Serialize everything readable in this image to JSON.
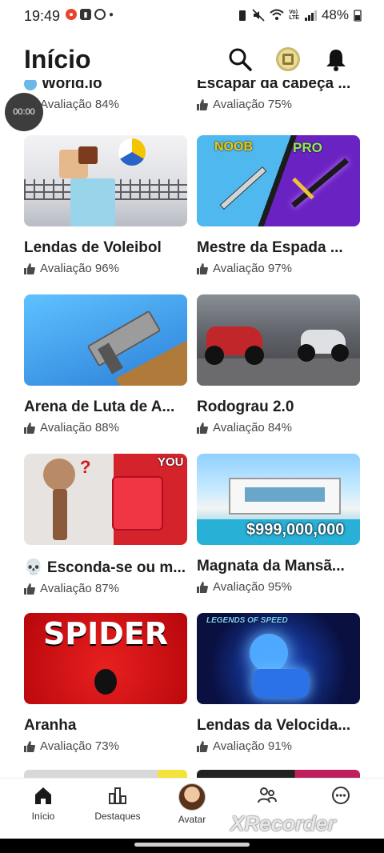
{
  "status": {
    "time": "19:49",
    "battery": "48%"
  },
  "header": {
    "title": "Início"
  },
  "partial": [
    {
      "title": "World.io",
      "rating": "Avaliação 84%"
    },
    {
      "title": "Escapar da cabeça ...",
      "rating": "Avaliação 75%"
    }
  ],
  "games": [
    {
      "title": "Lendas de Voleibol",
      "rating": "Avaliação 96%"
    },
    {
      "title": "Mestre da Espada ...",
      "rating": "Avaliação 97%",
      "thumb_left": "NOOB",
      "thumb_right": "PRO"
    },
    {
      "title": "Arena de Luta de A...",
      "rating": "Avaliação 88%"
    },
    {
      "title": "Rodograu 2.0",
      "rating": "Avaliação 84%"
    },
    {
      "title": "💀 Esconda-se ou m...",
      "rating": "Avaliação 87%",
      "thumb_text": "YOU"
    },
    {
      "title": "Magnata da Mansã...",
      "rating": "Avaliação 95%",
      "thumb_text": "$999,000,000"
    },
    {
      "title": "Aranha",
      "rating": "Avaliação 73%",
      "thumb_text": "SPIDER"
    },
    {
      "title": "Lendas da Velocida...",
      "rating": "Avaliação 91%",
      "thumb_text": "LEGENDS OF SPEED"
    }
  ],
  "timer": "00:00",
  "nav": [
    {
      "label": "Início",
      "icon": "home-icon"
    },
    {
      "label": "Destaques",
      "icon": "charts-icon"
    },
    {
      "label": "Avatar",
      "icon": "avatar-icon"
    },
    {
      "label": "",
      "icon": "friends-icon"
    },
    {
      "label": "",
      "icon": "more-icon"
    }
  ],
  "watermark": "XRecorder"
}
